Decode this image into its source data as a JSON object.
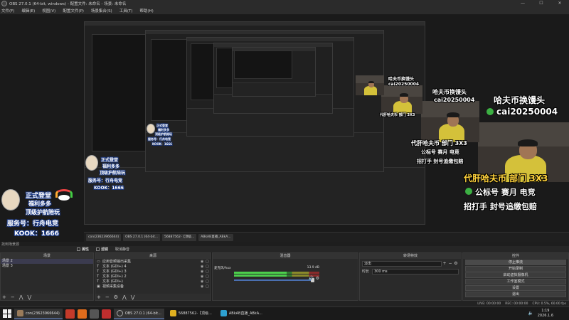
{
  "window": {
    "title": "OBS 27.0.1 (64-bit, windows) - 配置文件: 未命名 - 场景: 未命名",
    "controls": [
      "—",
      "☐",
      "✕"
    ]
  },
  "menu": [
    "文件(F)",
    "编辑(E)",
    "视图(V)",
    "配置文件(P)",
    "场景集合(S)",
    "工具(T)",
    "帮助(H)"
  ],
  "overlay": {
    "promo_lines": [
      "正式登堂",
      "福利多多",
      "顶级护航陪玩",
      "服务号：行舟电竞",
      "KOOK：1666"
    ],
    "cam_caption_1": "哈夫币换馒头",
    "cam_caption_2": "cai20250004",
    "cam_caption_3": "代肝哈夫币 部门 3X3",
    "cam_caption_4": "公标号 赛月 电竞",
    "cam_caption_5": "招打手 封号追缴包赔",
    "inner_tasks": [
      "con(23623966644)",
      "OBS 27.0.1 (64-bit...",
      "56887562-【顶级...",
      "ABkAB直播_ABkA..."
    ]
  },
  "statusline": "找到场景源",
  "preview_bar": {
    "stats": "属性",
    "filters": "滤镜",
    "transition": "取消静音"
  },
  "docks": {
    "scenes": {
      "title": "场景",
      "items": [
        "场景 2",
        "场景 3"
      ]
    },
    "sources": {
      "title": "来源",
      "items": [
        {
          "icon": "monitor-icon",
          "glyph": "▭",
          "label": "应用音频输出采集"
        },
        {
          "icon": "text-icon",
          "glyph": "T",
          "label": "文本 (GDI+) 4"
        },
        {
          "icon": "text-icon",
          "glyph": "T",
          "label": "文本 (GDI+) 3"
        },
        {
          "icon": "text-icon",
          "glyph": "T",
          "label": "文本 (GDI+) 2"
        },
        {
          "icon": "text-icon",
          "glyph": "T",
          "label": "文本 (GDI+)"
        },
        {
          "icon": "camera-icon",
          "glyph": "▣",
          "label": "视频采集设备"
        }
      ]
    },
    "mixer": {
      "title": "混音器",
      "channels": [
        {
          "name": "麦克风/Aux",
          "db": "13.9 dB",
          "level": 0.62
        },
        {
          "name": "桌面音频",
          "db": "0.0 dB",
          "level": 0.45
        }
      ]
    },
    "transitions": {
      "title": "转场特效",
      "selected": "淡出",
      "duration_label": "时长",
      "duration": "300 ms"
    },
    "controls": {
      "title": "控件",
      "buttons": [
        "停止推流",
        "开始录制",
        "启动虚拟摄像机",
        "工作室模式",
        "设置",
        "退出"
      ]
    }
  },
  "obs_status": {
    "live": "LIVE: 00:00:00",
    "rec": "REC: 00:00:00",
    "cpu": "CPU: 0.5%, 60.00 fps"
  },
  "taskbar": {
    "tasks": [
      "con(23623966644)",
      "OBS 27.0.1 (64-bit...",
      "56887562-【顶级...",
      "ABkAB直播_ABkA..."
    ],
    "time": "1:19",
    "date": "2026.1.6"
  },
  "colors": {
    "accent": "#7aa7ff",
    "meter_green": "#4cd04c",
    "bg": "#1e1e1e"
  }
}
